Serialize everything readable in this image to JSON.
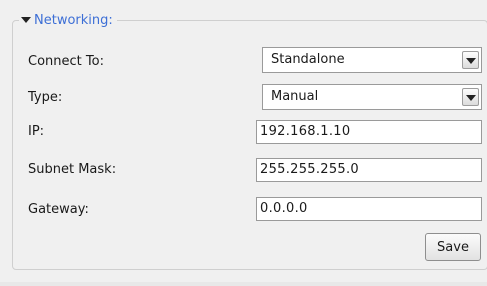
{
  "section": {
    "title": "Networking:",
    "expanded": true
  },
  "fields": {
    "connect_to": {
      "label": "Connect To:",
      "value": "Standalone"
    },
    "type": {
      "label": "Type:",
      "value": "Manual"
    },
    "ip": {
      "label": "IP:",
      "value": "192.168.1.10"
    },
    "subnet_mask": {
      "label": "Subnet Mask:",
      "value": "255.255.255.0"
    },
    "gateway": {
      "label": "Gateway:",
      "value": "0.0.0.0"
    }
  },
  "actions": {
    "save_label": "Save"
  },
  "colors": {
    "legend_text": "#3d6fd6",
    "background": "#f0f0f0"
  }
}
